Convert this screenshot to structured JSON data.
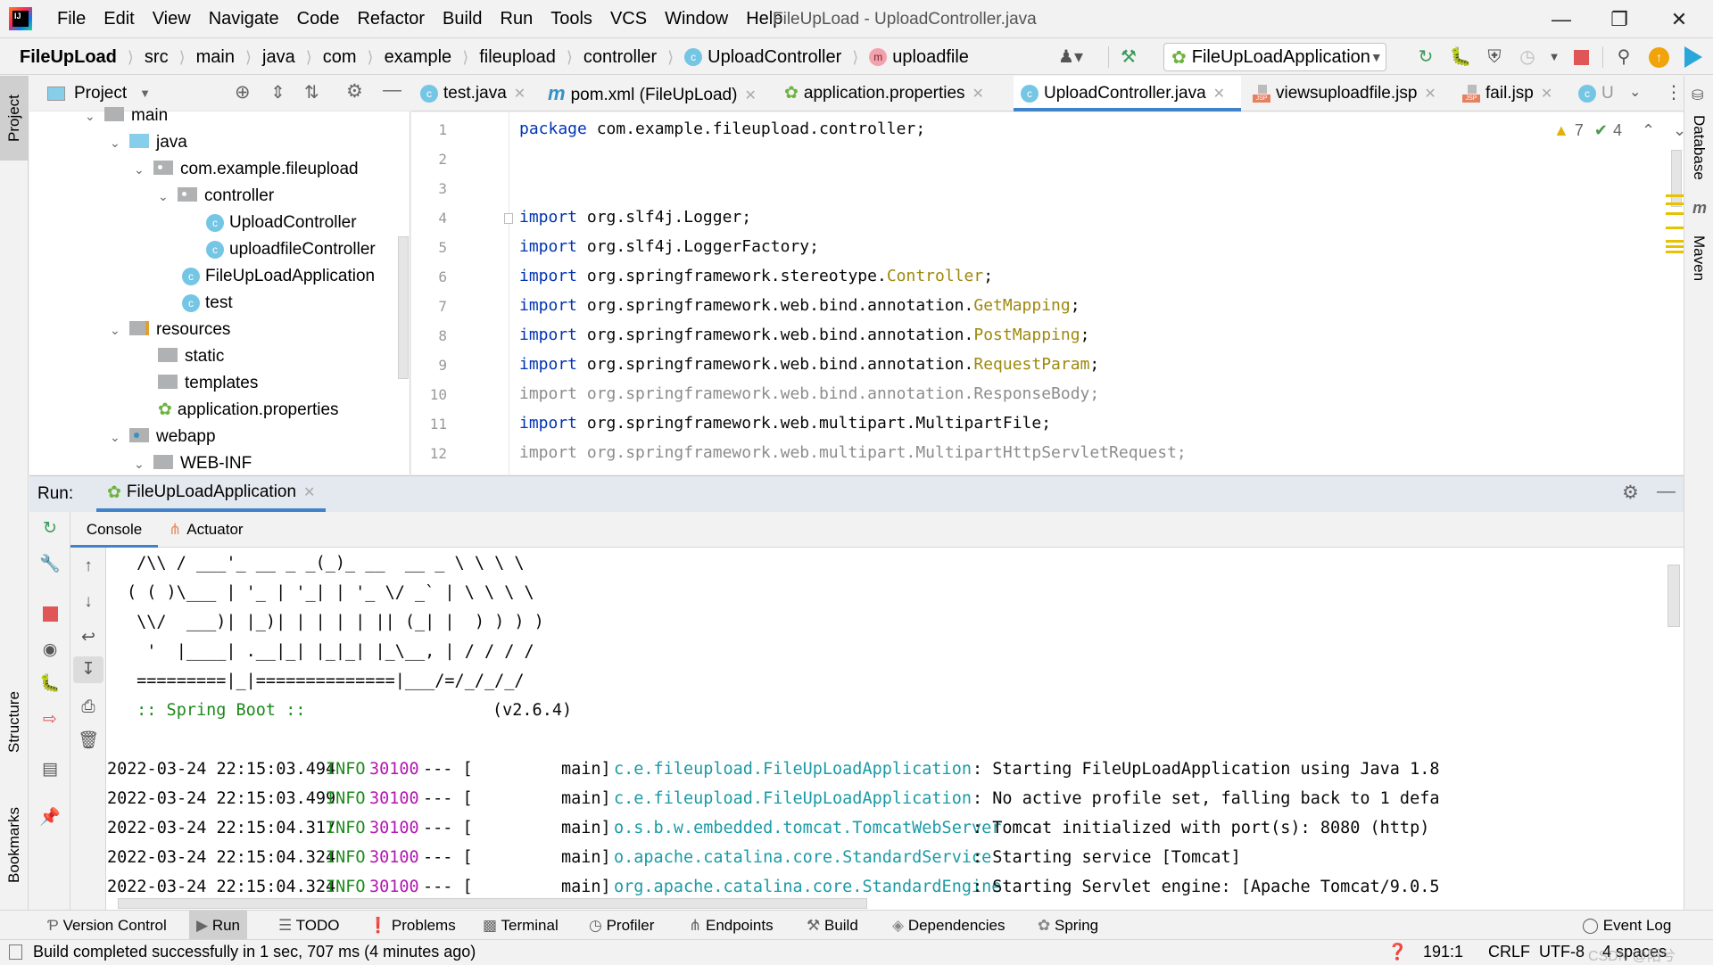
{
  "window": {
    "title": "FileUpLoad - UploadController.java",
    "menu": [
      "File",
      "Edit",
      "View",
      "Navigate",
      "Code",
      "Refactor",
      "Build",
      "Run",
      "Tools",
      "VCS",
      "Window",
      "Help"
    ]
  },
  "breadcrumb": {
    "items": [
      "FileUpLoad",
      "src",
      "main",
      "java",
      "com",
      "example",
      "fileupload",
      "controller",
      "UploadController",
      "uploadfile"
    ]
  },
  "toolbar": {
    "run_config": "FileUpLoadApplication"
  },
  "project": {
    "title": "Project",
    "tree": [
      {
        "label": "main",
        "type": "folder",
        "expanded": true
      },
      {
        "label": "java",
        "type": "source-folder",
        "expanded": true
      },
      {
        "label": "com.example.fileupload",
        "type": "package",
        "expanded": true
      },
      {
        "label": "controller",
        "type": "package",
        "expanded": true
      },
      {
        "label": "UploadController",
        "type": "class"
      },
      {
        "label": "uploadfileController",
        "type": "class"
      },
      {
        "label": "FileUpLoadApplication",
        "type": "spring-boot-class"
      },
      {
        "label": "test",
        "type": "class"
      },
      {
        "label": "resources",
        "type": "resources-folder",
        "expanded": true
      },
      {
        "label": "static",
        "type": "folder"
      },
      {
        "label": "templates",
        "type": "folder"
      },
      {
        "label": "application.properties",
        "type": "spring-properties"
      },
      {
        "label": "webapp",
        "type": "web-folder",
        "expanded": true
      },
      {
        "label": "WEB-INF",
        "type": "folder",
        "expanded": true
      }
    ]
  },
  "editor": {
    "tabs": [
      {
        "label": "test.java",
        "icon": "class"
      },
      {
        "label": "pom.xml (FileUpLoad)",
        "icon": "maven"
      },
      {
        "label": "application.properties",
        "icon": "spring"
      },
      {
        "label": "UploadController.java",
        "icon": "class",
        "active": true
      },
      {
        "label": "viewsuploadfile.jsp",
        "icon": "jsp"
      },
      {
        "label": "fail.jsp",
        "icon": "jsp"
      },
      {
        "label": "U",
        "icon": "class"
      }
    ],
    "warnings": "7",
    "weak_warnings": "4",
    "lines": [
      {
        "n": "1",
        "kw": "package",
        "rest": " com.example.fileupload.controller;",
        "type": "",
        "end": ""
      },
      {
        "n": "2",
        "kw": "",
        "rest": "",
        "type": "",
        "end": ""
      },
      {
        "n": "3",
        "kw": "",
        "rest": "",
        "type": "",
        "end": ""
      },
      {
        "n": "4",
        "kw": "import",
        "rest": " org.slf4j.Logger;",
        "type": "",
        "end": ""
      },
      {
        "n": "5",
        "kw": "import",
        "rest": " org.slf4j.LoggerFactory;",
        "type": "",
        "end": ""
      },
      {
        "n": "6",
        "kw": "import",
        "rest": " org.springframework.stereotype.",
        "type": "Controller",
        "end": ";"
      },
      {
        "n": "7",
        "kw": "import",
        "rest": " org.springframework.web.bind.annotation.",
        "type": "GetMapping",
        "end": ";"
      },
      {
        "n": "8",
        "kw": "import",
        "rest": " org.springframework.web.bind.annotation.",
        "type": "PostMapping",
        "end": ";"
      },
      {
        "n": "9",
        "kw": "import",
        "rest": " org.springframework.web.bind.annotation.",
        "type": "RequestParam",
        "end": ";"
      },
      {
        "n": "10",
        "kw": "import",
        "rest": " org.springframework.web.bind.annotation.ResponseBody;",
        "type": "",
        "end": "",
        "unused": true
      },
      {
        "n": "11",
        "kw": "import",
        "rest": " org.springframework.web.multipart.MultipartFile;",
        "type": "",
        "end": ""
      },
      {
        "n": "12",
        "kw": "import",
        "rest": " org.springframework.web.multipart.MultipartHttpServletRequest;",
        "type": "",
        "end": "",
        "unused": true
      }
    ]
  },
  "run": {
    "label": "Run:",
    "config_tab": "FileUpLoadApplication",
    "subtabs": [
      "Console",
      "Actuator"
    ],
    "banner": [
      " /\\\\ / ___'_ __ _ _(_)_ __  __ _ \\ \\ \\ \\",
      "( ( )\\___ | '_ | '_| | '_ \\/ _` | \\ \\ \\ \\",
      " \\\\/  ___)| |_)| | | | | || (_| |  ) ) ) )",
      "  '  |____| .__|_| |_|_| |_\\__, | / / / /",
      " =========|_|==============|___/=/_/_/_/"
    ],
    "spring_boot_label": " :: Spring Boot ::",
    "spring_boot_version": "(v2.6.4)",
    "logs": [
      {
        "ts": "2022-03-24 22:15:03.494",
        "level": "INFO",
        "pid": "30100",
        "sep": "--- [",
        "thread": "main]",
        "logger": "c.e.fileupload.FileUpLoadApplication    ",
        "msg": ": Starting FileUpLoadApplication using Java 1.8"
      },
      {
        "ts": "2022-03-24 22:15:03.499",
        "level": "INFO",
        "pid": "30100",
        "sep": "--- [",
        "thread": "main]",
        "logger": "c.e.fileupload.FileUpLoadApplication    ",
        "msg": ": No active profile set, falling back to 1 defa"
      },
      {
        "ts": "2022-03-24 22:15:04.317",
        "level": "INFO",
        "pid": "30100",
        "sep": "--- [",
        "thread": "main]",
        "logger": "o.s.b.w.embedded.tomcat.TomcatWebServer ",
        "msg": ": Tomcat initialized with port(s): 8080 (http)"
      },
      {
        "ts": "2022-03-24 22:15:04.324",
        "level": "INFO",
        "pid": "30100",
        "sep": "--- [",
        "thread": "main]",
        "logger": "o.apache.catalina.core.StandardService  ",
        "msg": ": Starting service [Tomcat]"
      },
      {
        "ts": "2022-03-24 22:15:04.324",
        "level": "INFO",
        "pid": "30100",
        "sep": "--- [",
        "thread": "main]",
        "logger": "org.apache.catalina.core.StandardEngine ",
        "msg": ": Starting Servlet engine: [Apache Tomcat/9.0.5"
      }
    ]
  },
  "side_tabs": {
    "left": [
      "Project",
      "Structure",
      "Bookmarks"
    ],
    "right": [
      "Database",
      "Maven"
    ]
  },
  "bottom_tools": [
    "Version Control",
    "Run",
    "TODO",
    "Problems",
    "Terminal",
    "Profiler",
    "Endpoints",
    "Build",
    "Dependencies",
    "Spring",
    "Event Log"
  ],
  "status": {
    "message": "Build completed successfully in 1 sec, 707 ms (4 minutes ago)",
    "position": "191:1",
    "line_sep": "CRLF",
    "encoding": "UTF-8",
    "indent": "4 spaces",
    "watermark": "CSDN @陌兮"
  },
  "colors": {
    "keyword": "#0033b3",
    "annotation_type": "#9e880d",
    "info": "#1c8a1c",
    "pid": "#b117b1",
    "logger": "#1b9aa6",
    "accent": "#4083c9",
    "stop": "#e05555"
  }
}
